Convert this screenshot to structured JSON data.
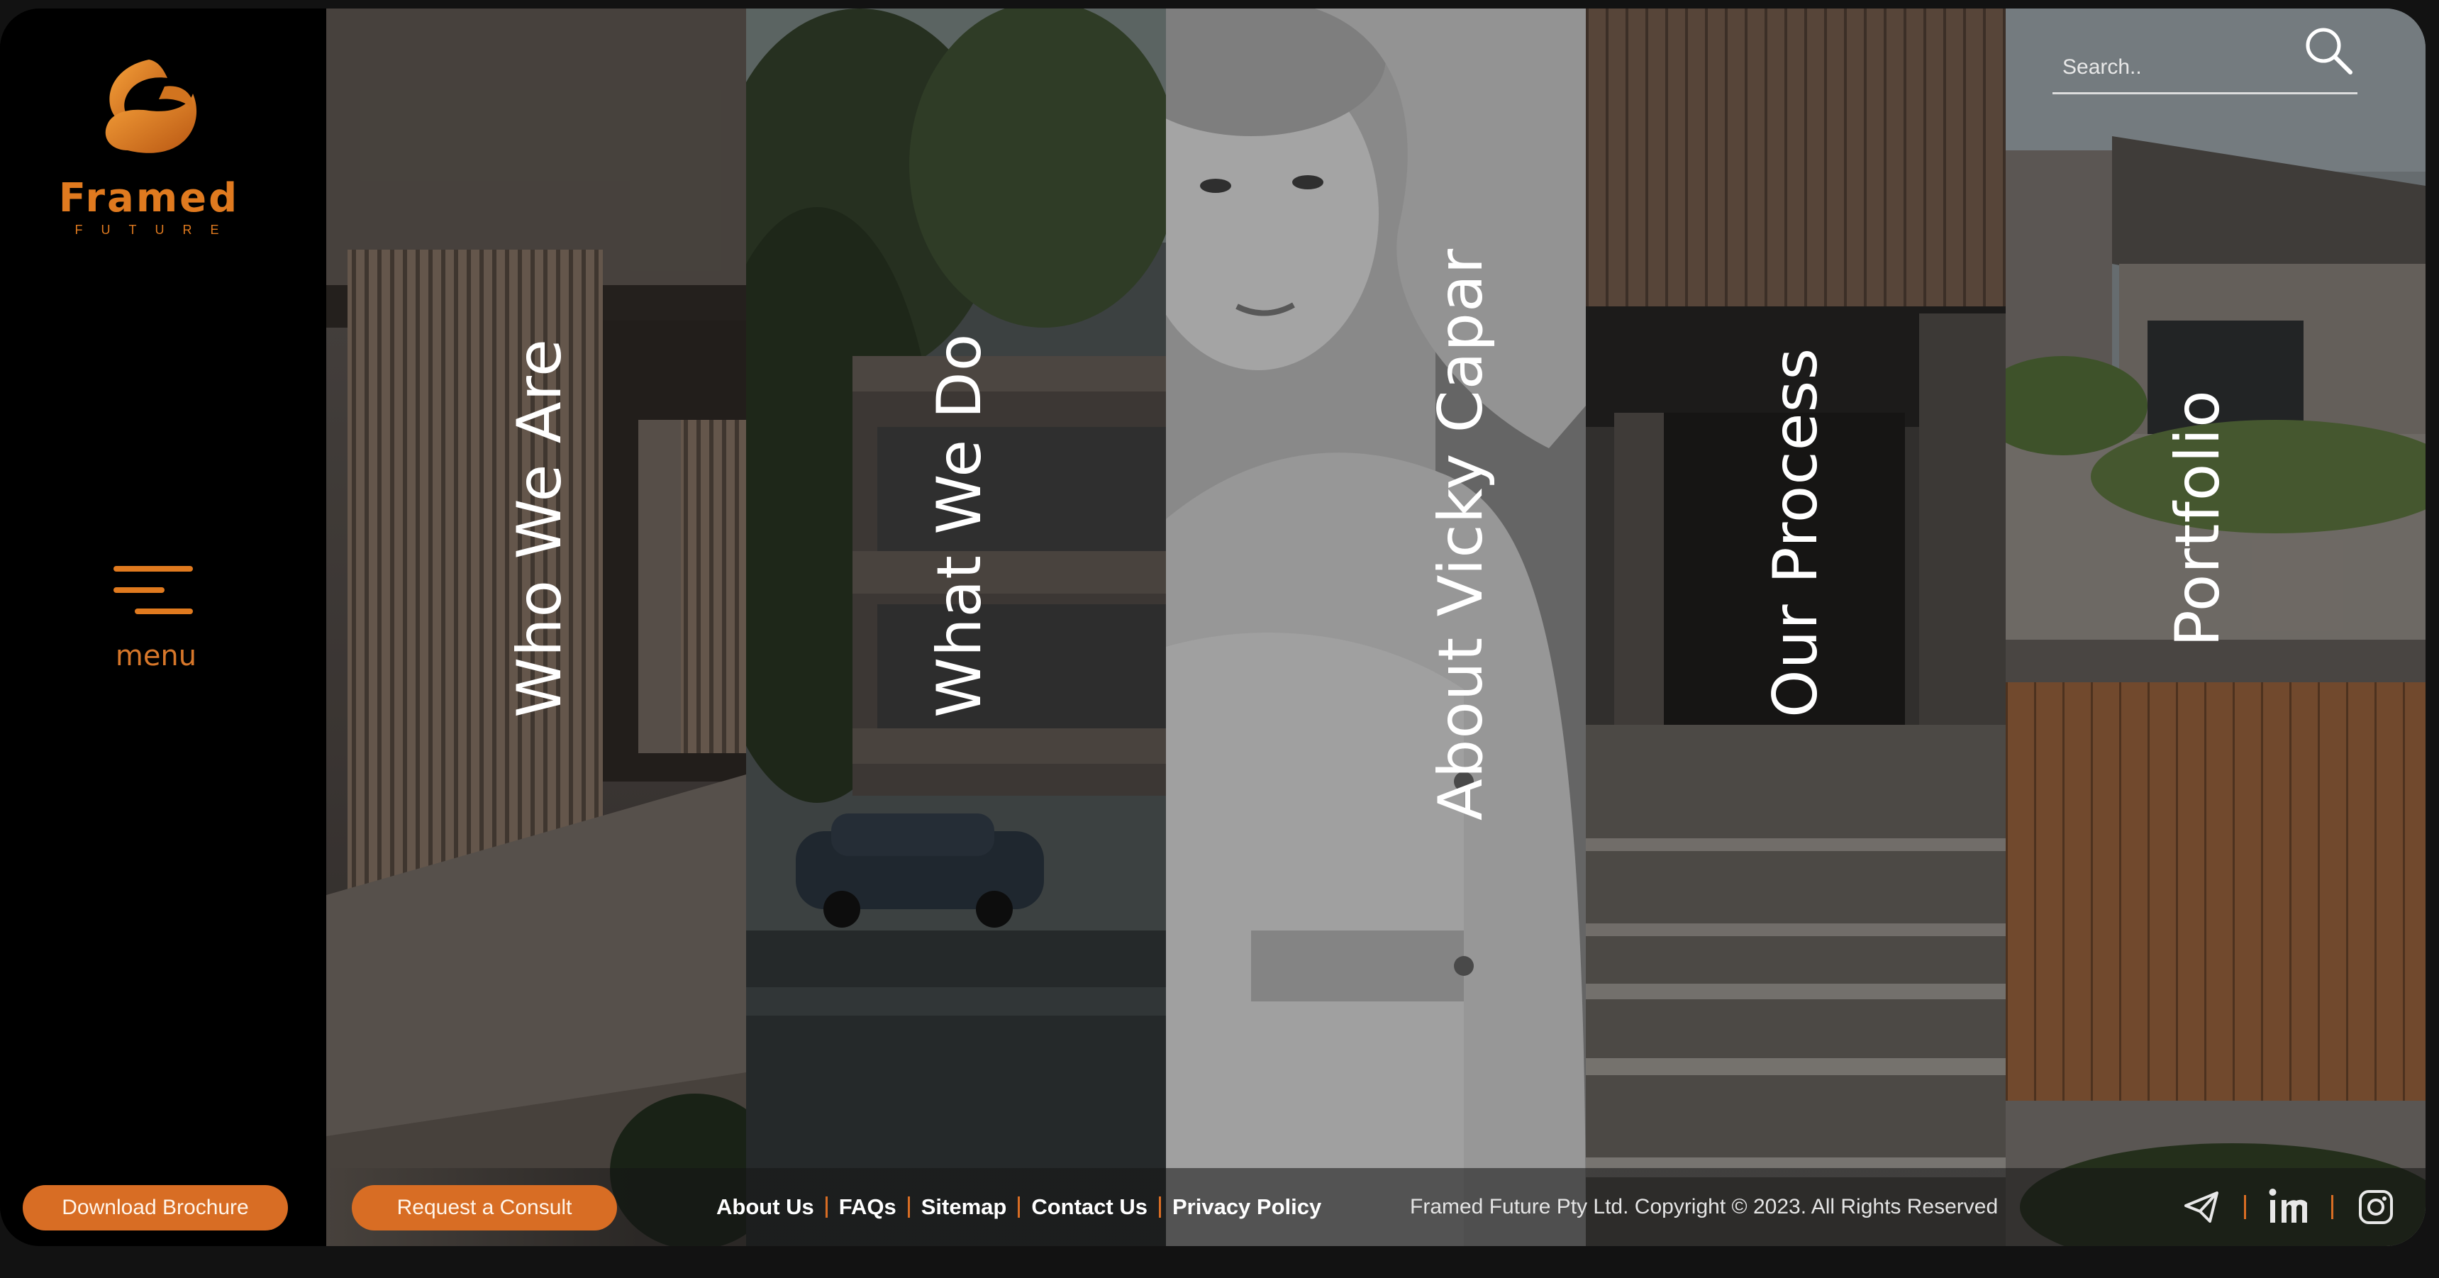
{
  "brand": {
    "name": "Framed",
    "tagline": "FUTURE",
    "accent_color": "#e07a1f"
  },
  "menu": {
    "label": "menu",
    "icon": "hamburger-icon"
  },
  "search": {
    "placeholder": "Search..",
    "icon": "search-icon"
  },
  "panels": [
    {
      "label": "Who We Are",
      "image": "modern house facade with timber battens"
    },
    {
      "label": "What We Do",
      "image": "three-storey house at dusk with vintage car"
    },
    {
      "label": "About Vicky Capar",
      "image": "black and white portrait"
    },
    {
      "label": "Our Process",
      "image": "concrete steps to timber-clad entrance"
    },
    {
      "label": "Portfolio",
      "image": "house with concrete balcony and plants"
    }
  ],
  "footer": {
    "download_label": "Download Brochure",
    "consult_label": "Request a Consult",
    "links": [
      "About Us",
      "FAQs",
      "Sitemap",
      "Contact Us",
      "Privacy Policy"
    ],
    "copyright": "Framed Future Pty Ltd. Copyright © 2023.  All Rights Reserved",
    "social": [
      "telegram-icon",
      "linkedin-icon",
      "instagram-icon"
    ]
  }
}
